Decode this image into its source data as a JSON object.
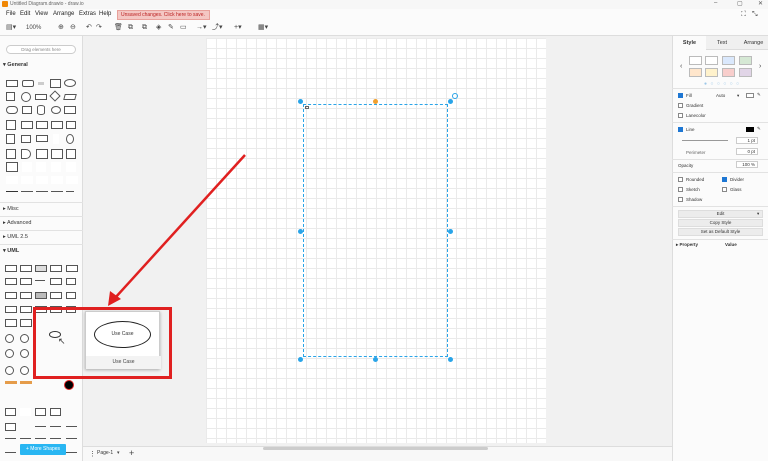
{
  "window": {
    "title": "Untitled Diagram.drawio - draw.io",
    "minimize": "–",
    "maximize": "▢",
    "close": "✕"
  },
  "menu": {
    "items": [
      "File",
      "Edit",
      "View",
      "Arrange",
      "Extras",
      "Help"
    ],
    "unsaved": "Unsaved changes. Click here to save."
  },
  "toolbar": {
    "zoom": "100%"
  },
  "sidebar": {
    "search_placeholder": "Drag elements here",
    "sections": {
      "general": "General",
      "misc": "Misc",
      "advanced": "Advanced",
      "uml25": "UML 2.5",
      "uml": "UML"
    },
    "more_shapes": "+ More Shapes"
  },
  "popup": {
    "shape_text": "Use Case",
    "shape_name": "Use Case"
  },
  "footer": {
    "page_tab": "Page-1"
  },
  "panel": {
    "tabs": [
      "Style",
      "Text",
      "Arrange"
    ],
    "fill_label": "Fill",
    "fill_mode": "Auto",
    "gradient_label": "Gradient",
    "lanecolor_label": "Lanecolor",
    "line_label": "Line",
    "line_width": "1 pt",
    "perimeter_label": "Perimeter",
    "perimeter_value": "0 pt",
    "opacity_label": "Opacity",
    "opacity_value": "100 %",
    "rounded_label": "Rounded",
    "divider_label": "Divider",
    "sketch_label": "Sketch",
    "glass_label": "Glass",
    "shadow_label": "Shadow",
    "edit_label": "Edit",
    "copy_style": "Copy Style",
    "set_default": "Set as Default Style",
    "property_header": "Property",
    "value_header": "Value"
  },
  "colors": {
    "accent": "#29a4e8",
    "arrow": "#e02020",
    "more_shapes_bg": "#29b6f2",
    "fill_swatches": [
      "#ffffff",
      "#ffffff",
      "#dae8fc",
      "#d5e8d4",
      "#ffe6cc",
      "#fff2cc",
      "#f8cecc",
      "#e1d5e7"
    ]
  }
}
